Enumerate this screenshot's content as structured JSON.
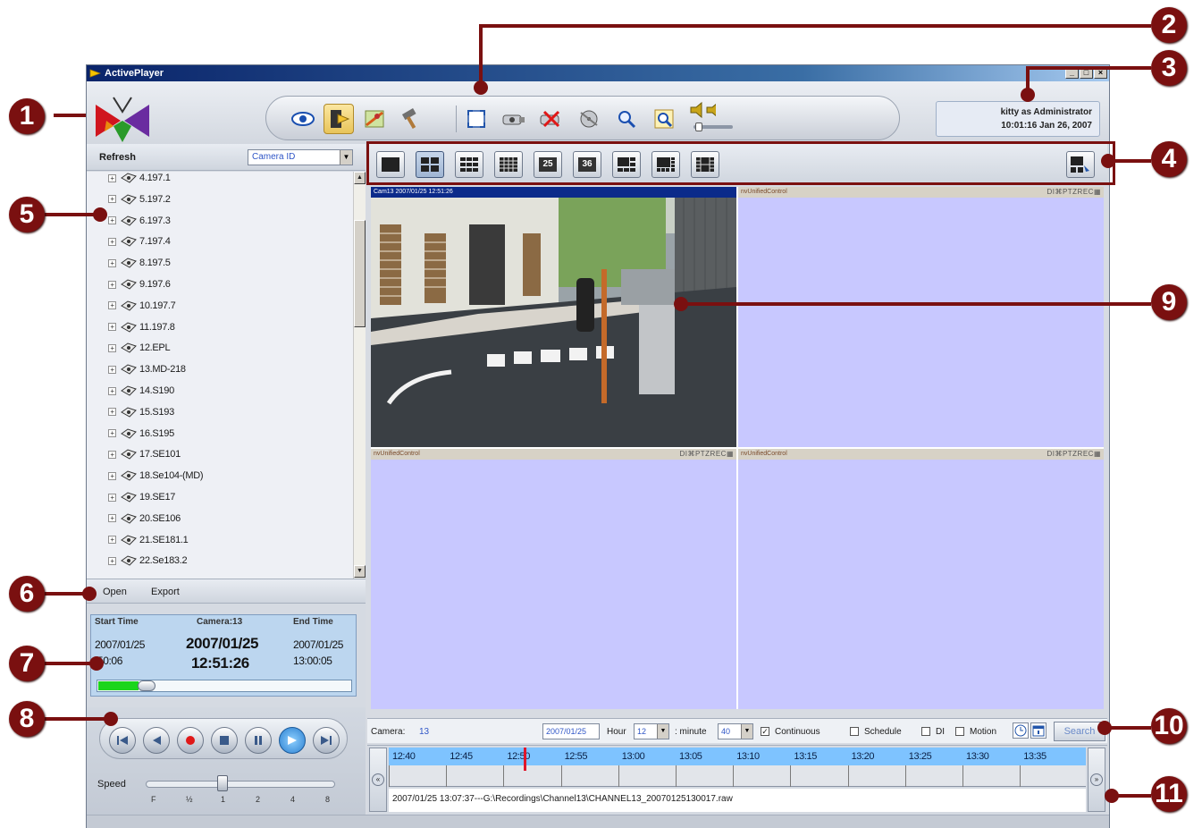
{
  "window": {
    "title": "ActivePlayer",
    "controls": [
      "_",
      "□",
      "×"
    ]
  },
  "header": {
    "user_line": "kitty as Administrator",
    "datetime": "10:01:16 Jan 26, 2007",
    "toolbar_icons": [
      "eye-icon",
      "folder-tag-icon",
      "map-icon",
      "hammer-icon",
      "fullscreen-icon",
      "camera-snapshot-icon",
      "delete-camera-icon",
      "film-reel-icon",
      "zoom-icon",
      "zoom-fit-icon",
      "volume-icon"
    ]
  },
  "left_panel": {
    "refresh_label": "Refresh",
    "sort_select": "Camera ID",
    "tree": [
      "4.197.1",
      "5.197.2",
      "6.197.3",
      "7.197.4",
      "8.197.5",
      "9.197.6",
      "10.197.7",
      "11.197.8",
      "12.EPL",
      "13.MD-218",
      "14.S190",
      "15.S193",
      "16.S195",
      "17.SE101",
      "18.Se104-(MD)",
      "19.SE17",
      "20.SE106",
      "21.SE181.1",
      "22.Se183.2"
    ],
    "menu": {
      "open": "Open",
      "export": "Export"
    },
    "timebox": {
      "start_label": "Start Time",
      "camera_label": "Camera:13",
      "end_label": "End Time",
      "start_date": "2007/01/25",
      "start_time": ":50:06",
      "current_date": "2007/01/25",
      "current_time": "12:51:26",
      "end_date": "2007/01/25",
      "end_time": "13:00:05",
      "progress": 0.16
    },
    "speed": {
      "label": "Speed",
      "ticks": [
        "F",
        "½",
        "1",
        "2",
        "4",
        "8"
      ],
      "value_index": 2
    }
  },
  "video": {
    "cells": [
      {
        "header": "Cam13 2007/01/25 12:51:26",
        "flags": "",
        "live": true
      },
      {
        "header": "nvUnifiedControl",
        "flags": "DI⌘PTZREC▦",
        "live": false
      },
      {
        "header": "nvUnifiedControl",
        "flags": "DI⌘PTZREC▦",
        "live": false
      },
      {
        "header": "nvUnifiedControl",
        "flags": "DI⌘PTZREC▦",
        "live": false
      }
    ]
  },
  "layouts": [
    "1",
    "4",
    "9",
    "16",
    "25",
    "36",
    "6",
    "8",
    "13"
  ],
  "search": {
    "camera_label": "Camera:",
    "camera_value": "13",
    "date_value": "2007/01/25",
    "hour_label": "Hour",
    "hour_value": "12",
    "minute_label": ": minute",
    "minute_value": "40",
    "continuous_label": "Continuous",
    "schedule_label": "Schedule",
    "di_label": "DI",
    "motion_label": "Motion",
    "search_label": "Search"
  },
  "timeline": {
    "ticks": [
      "12:40",
      "12:45",
      "12:50",
      "12:55",
      "13:00",
      "13:05",
      "13:10",
      "13:15",
      "13:20",
      "13:25",
      "13:30",
      "13:35"
    ],
    "file": "2007/01/25 13:07:37---G:\\Recordings\\Channel13\\CHANNEL13_20070125130017.raw",
    "marker_time": "12:51:26"
  },
  "callouts": [
    "1",
    "2",
    "3",
    "4",
    "5",
    "6",
    "7",
    "8",
    "9",
    "10",
    "11"
  ]
}
